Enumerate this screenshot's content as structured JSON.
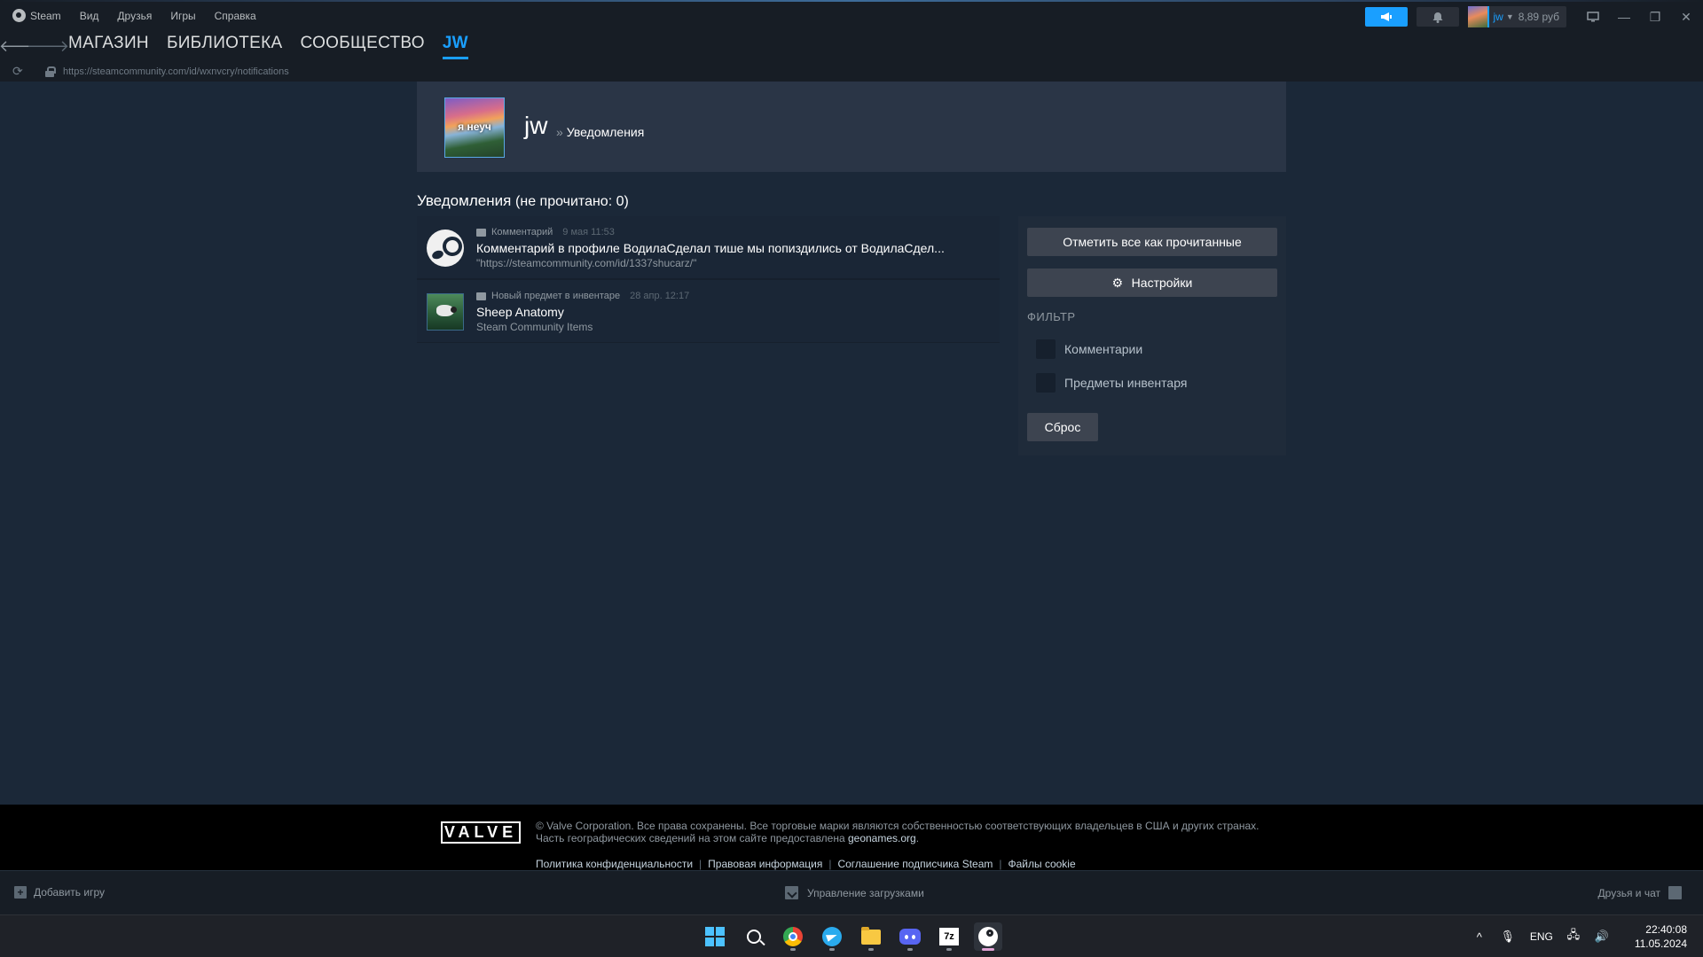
{
  "window": {
    "menu": [
      "Steam",
      "Вид",
      "Друзья",
      "Игры",
      "Справка"
    ],
    "user": {
      "name": "jw",
      "balance": "8,89 руб"
    },
    "controls": {
      "minimize": "—",
      "restore": "❐",
      "close": "✕"
    }
  },
  "nav": {
    "back_glyph": "🡐",
    "forward_glyph": "🡒",
    "links": [
      "МАГАЗИН",
      "БИБЛИОТЕКА",
      "СООБЩЕСТВО",
      "JW"
    ],
    "active_index": 3
  },
  "urlbar": {
    "reload_glyph": "⟳",
    "url": "https://steamcommunity.com/id/wxnvcry/notifications"
  },
  "profile": {
    "avatar_text": "я неуч",
    "name": "jw",
    "separator": "»",
    "crumb": "Уведомления"
  },
  "notifications": {
    "title": "Уведомления",
    "unread_text": "(не прочитано: 0)",
    "items": [
      {
        "icon": "steam-logo-icon",
        "type": "Комментарий",
        "time": "9 мая 11:53",
        "title": "Комментарий в профиле ВодилаСделал тише мы попиздились от ВодилаСдел...",
        "subtitle": "\"https://steamcommunity.com/id/1337shucarz/\""
      },
      {
        "icon": "sheep-anatomy-thumbnail",
        "type": "Новый предмет в инвентаре",
        "time": "28 апр. 12:17",
        "title": "Sheep Anatomy",
        "subtitle": "Steam Community Items"
      }
    ]
  },
  "side_panel": {
    "mark_all_label": "Отметить все как прочитанные",
    "settings_label": "Настройки",
    "filter_title": "ФИЛЬТР",
    "filters": [
      {
        "label": "Комментарии",
        "checked": false
      },
      {
        "label": "Предметы инвентаря",
        "checked": false
      }
    ],
    "reset_label": "Сброс"
  },
  "footer": {
    "logo": "VALVE",
    "legal_line1": "© Valve Corporation. Все права сохранены. Все торговые марки являются собственностью соответствующих владельцев в США и других странах.",
    "legal_line2_prefix": "Часть географических сведений на этом сайте предоставлена ",
    "legal_line2_link": "geonames.org",
    "legal_line2_suffix": ".",
    "links": [
      "Политика конфиденциальности",
      "Правовая информация",
      "Соглашение подписчика Steam",
      "Файлы cookie"
    ],
    "link_separator": "|"
  },
  "statusbar": {
    "add_game_glyph": "+",
    "add_game": "Добавить игру",
    "downloads": "Управление загрузками",
    "friends": "Друзья и чат"
  },
  "taskbar": {
    "apps": [
      "windows-start-icon",
      "search-icon",
      "chrome-icon",
      "telegram-icon",
      "file-explorer-icon",
      "discord-icon",
      "7zip-icon",
      "steam-icon"
    ],
    "z7_label": "7z",
    "tray_chevron": "^",
    "tray_mic": "🎙",
    "tray_network": "🖧",
    "tray_volume": "🔊",
    "language": "ENG",
    "time": "22:40:08",
    "date": "11.05.2024"
  },
  "colors": {
    "background": "#1b2838",
    "accent": "#1a9fff",
    "panel": "#2a3546",
    "button": "#3d4450"
  }
}
